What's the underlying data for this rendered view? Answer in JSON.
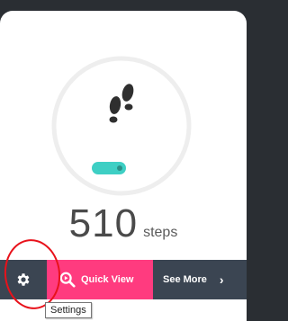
{
  "tracker": {
    "step_count": "510",
    "step_unit": "steps",
    "progress_icon": "footsteps-icon"
  },
  "action_bar": {
    "settings_icon": "gear-icon",
    "quick_view_label": "Quick View",
    "quick_view_icon": "magnifier-icon",
    "see_more_label": "See More",
    "see_more_icon": "chevron-right-icon"
  },
  "tooltip": {
    "text": "Settings"
  },
  "colors": {
    "accent_pink": "#ff3b7f",
    "progress_teal": "#3ecfc4",
    "bar_dark": "#3b4552",
    "annotation_red": "#e8121b"
  }
}
